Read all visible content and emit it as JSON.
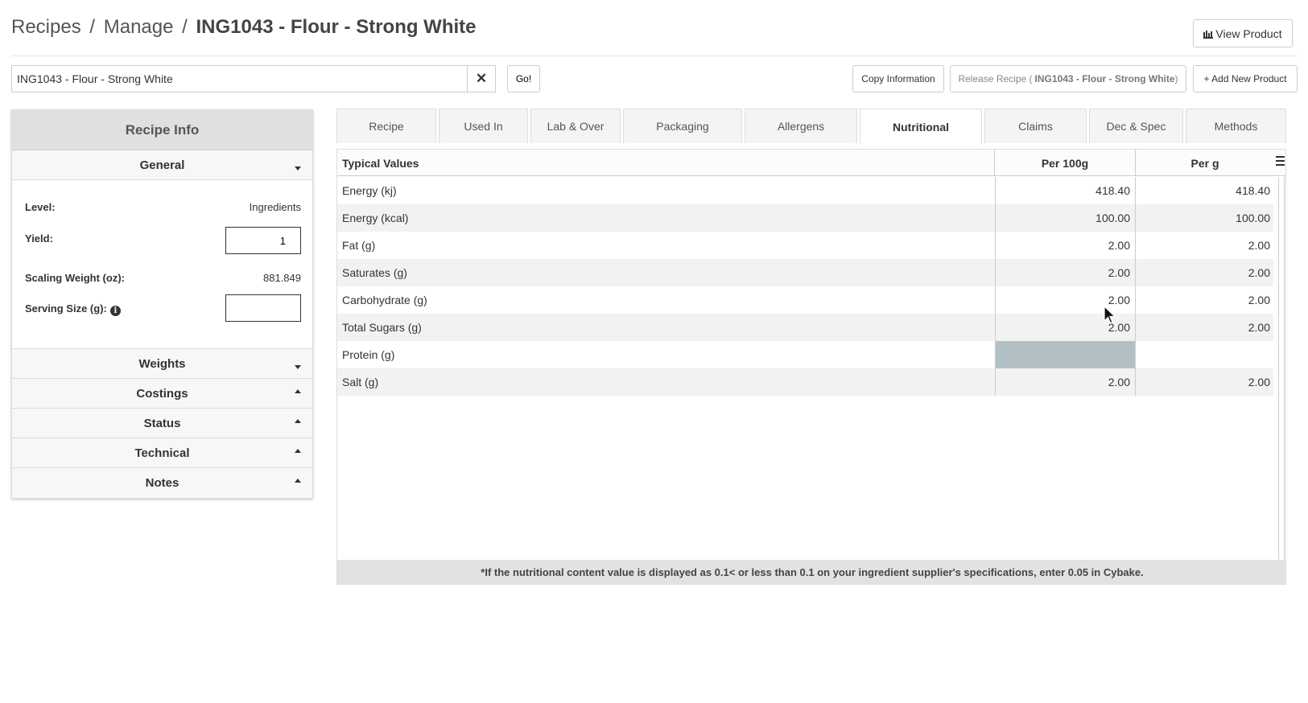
{
  "header": {
    "breadcrumb_recipes": "Recipes",
    "breadcrumb_sep1": "/",
    "breadcrumb_manage": "Manage",
    "breadcrumb_sep2": "/",
    "breadcrumb_current": "ING1043 - Flour - Strong White",
    "view_product_label": "View Product",
    "view_product_icon": "industry-icon"
  },
  "search": {
    "value": "ING1043 - Flour - Strong White",
    "clear_icon": "close-icon",
    "go_label": "Go!"
  },
  "actions": {
    "copy_label": "Copy Information",
    "release_prefix": "Release Recipe (",
    "release_name": "ING1043 - Flour - Strong White",
    "release_suffix": ")",
    "add_label": "+ Add New Product"
  },
  "recipe_info": {
    "title": "Recipe Info",
    "general": {
      "label": "General",
      "level_label": "Level:",
      "level_value": "Ingredients",
      "yield_label": "Yield:",
      "yield_value": "1",
      "scaling_label": "Scaling Weight (oz):",
      "scaling_value": "881.849",
      "serving_label": "Serving Size (g):",
      "serving_value": ""
    },
    "sections": [
      {
        "label": "Weights",
        "state": "collapsed"
      },
      {
        "label": "Costings",
        "state": "expanded"
      },
      {
        "label": "Status",
        "state": "expanded"
      },
      {
        "label": "Technical",
        "state": "expanded"
      },
      {
        "label": "Notes",
        "state": "expanded"
      }
    ]
  },
  "tabs": [
    {
      "label": "Recipe",
      "active": false
    },
    {
      "label": "Used In",
      "active": false
    },
    {
      "label": "Lab & Over",
      "active": false
    },
    {
      "label": "Packaging",
      "active": false
    },
    {
      "label": "Allergens",
      "active": false
    },
    {
      "label": "Nutritional",
      "active": true
    },
    {
      "label": "Claims",
      "active": false
    },
    {
      "label": "Dec & Spec",
      "active": false
    },
    {
      "label": "Methods",
      "active": false
    }
  ],
  "nutrition": {
    "headers": [
      "Typical Values",
      "Per 100g",
      "Per g"
    ],
    "rows": [
      {
        "name": "Energy (kj)",
        "per100": "418.40",
        "perg": "418.40"
      },
      {
        "name": "Energy (kcal)",
        "per100": "100.00",
        "perg": "100.00"
      },
      {
        "name": "Fat (g)",
        "per100": "2.00",
        "perg": "2.00"
      },
      {
        "name": "Saturates (g)",
        "per100": "2.00",
        "perg": "2.00"
      },
      {
        "name": "Carbohydrate (g)",
        "per100": "2.00",
        "perg": "2.00"
      },
      {
        "name": "Total Sugars (g)",
        "per100": "2.00",
        "perg": "2.00"
      },
      {
        "name": "Protein (g)",
        "per100": "",
        "perg": ""
      },
      {
        "name": "Salt (g)",
        "per100": "2.00",
        "perg": "2.00"
      }
    ],
    "footnote": "*If the nutritional content value is displayed as 0.1< or less than 0.1 on your ingredient supplier's specifications, enter 0.05 in Cybake."
  },
  "colors": {
    "selected_cell": "#b2c0c4",
    "panel_header": "#e0e0e0",
    "stripe": "#f2f2f2"
  }
}
